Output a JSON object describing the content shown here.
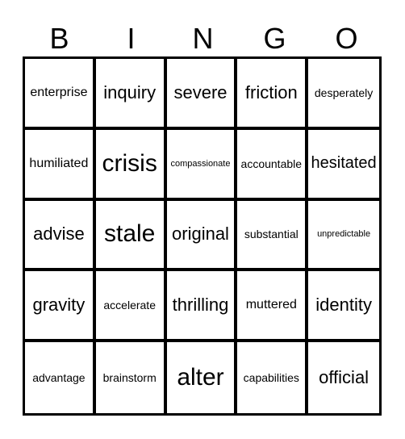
{
  "header": {
    "letters": [
      "B",
      "I",
      "N",
      "G",
      "O"
    ]
  },
  "board": {
    "rows": [
      [
        "enterprise",
        "inquiry",
        "severe",
        "friction",
        "desperately"
      ],
      [
        "humiliated",
        "crisis",
        "compassionate",
        "accountable",
        "hesitated"
      ],
      [
        "advise",
        "stale",
        "original",
        "substantial",
        "unpredictable"
      ],
      [
        "gravity",
        "accelerate",
        "thrilling",
        "muttered",
        "identity"
      ],
      [
        "advantage",
        "brainstorm",
        "alter",
        "capabilities",
        "official"
      ]
    ]
  }
}
